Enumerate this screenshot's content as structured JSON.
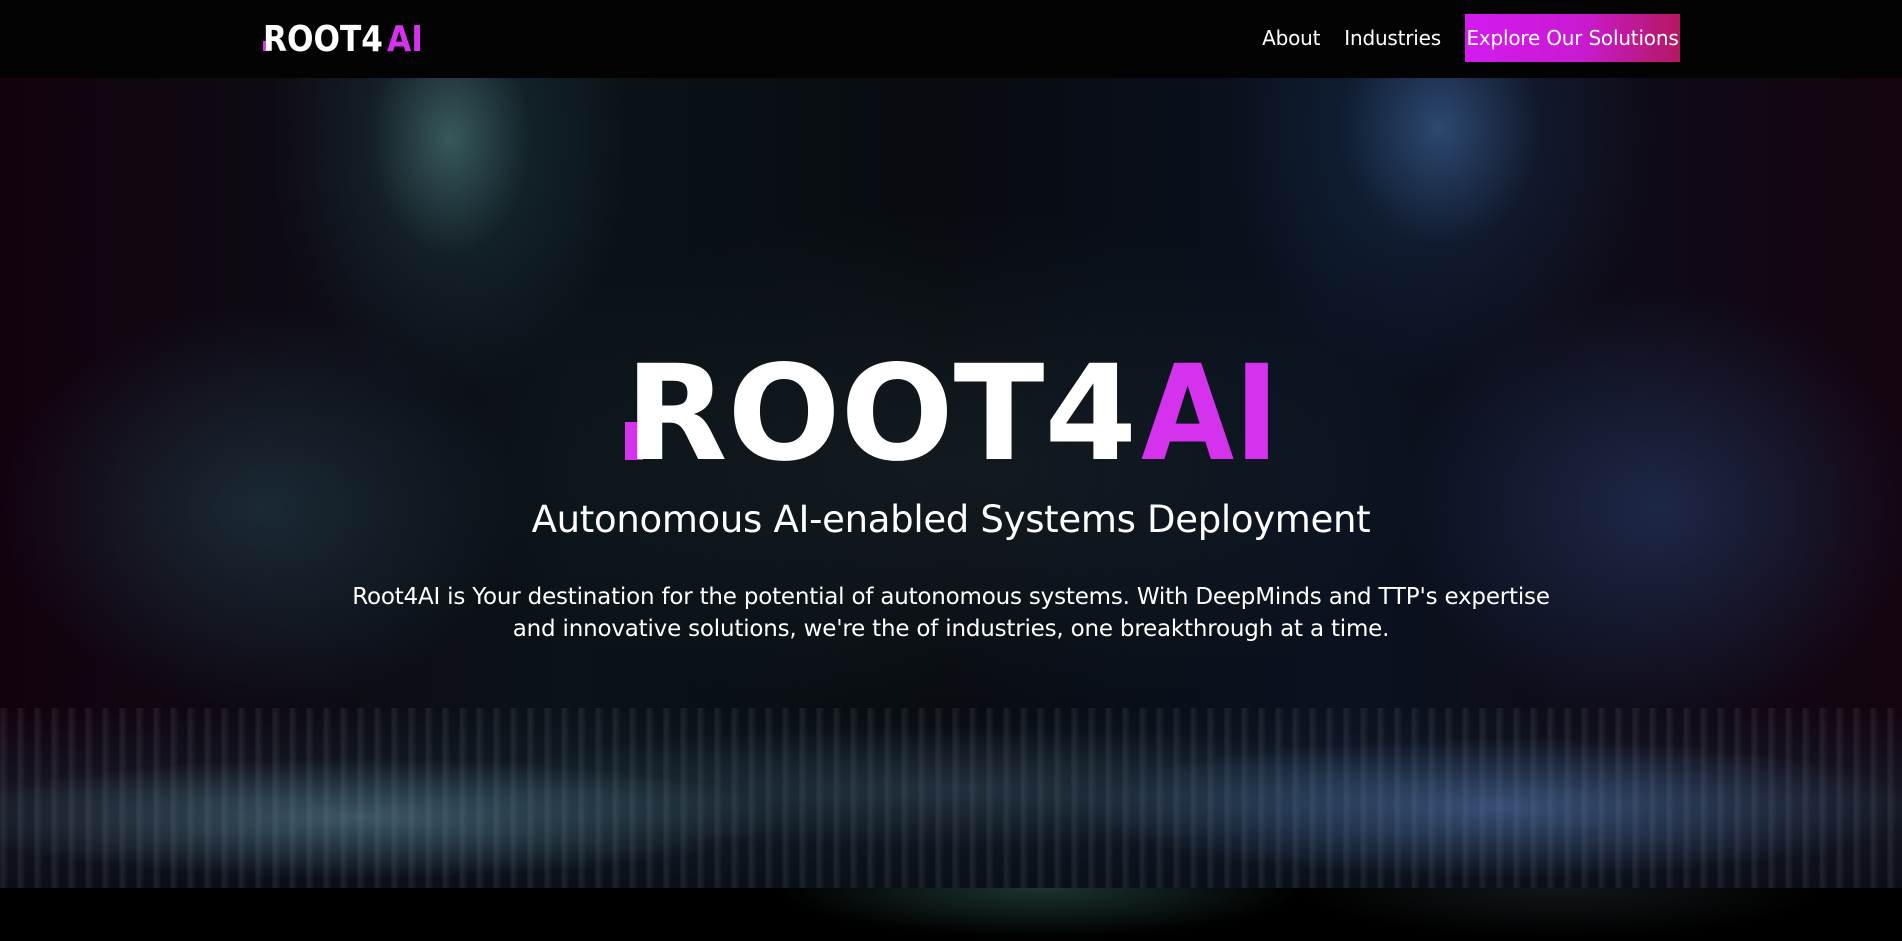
{
  "nav": {
    "logo": {
      "text_main": "ROOT4",
      "text_accent": "AI"
    },
    "links": [
      {
        "label": "About"
      },
      {
        "label": "Industries"
      }
    ],
    "cta_label": "Explore Our Solutions"
  },
  "hero": {
    "logo": {
      "text_main": "ROOT4",
      "text_accent": "AI"
    },
    "subtitle": "Autonomous AI-enabled Systems Deployment",
    "description": "Root4AI is Your destination for the potential of autonomous systems. With DeepMinds and TTP's expertise and innovative solutions, we're the of industries, one breakthrough at a time."
  },
  "colors": {
    "brand_accent": "#d532ee",
    "cta_gradient_start": "#d31bf0",
    "cta_gradient_end": "#b5185f",
    "navbar_bg": "#030303"
  }
}
